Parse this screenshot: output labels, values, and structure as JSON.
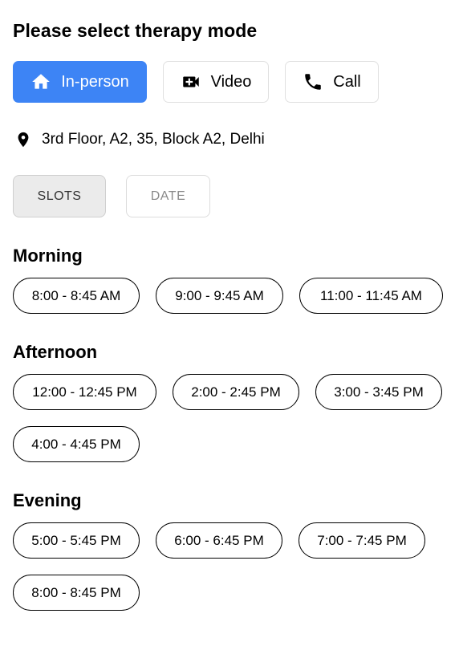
{
  "header": {
    "title": "Please select therapy mode"
  },
  "modes": [
    {
      "label": "In-person",
      "icon": "home-icon",
      "active": true
    },
    {
      "label": "Video",
      "icon": "video-camera-icon",
      "active": false
    },
    {
      "label": "Call",
      "icon": "phone-icon",
      "active": false
    }
  ],
  "address": {
    "icon": "location-pin-icon",
    "text": "3rd Floor, A2, 35, Block A2, Delhi"
  },
  "tabs": [
    {
      "label": "SLOTS",
      "active": true
    },
    {
      "label": "DATE",
      "active": false
    }
  ],
  "sections": [
    {
      "title": "Morning",
      "slots": [
        "8:00 - 8:45 AM",
        "9:00 - 9:45 AM",
        "11:00 - 11:45 AM"
      ]
    },
    {
      "title": "Afternoon",
      "slots": [
        "12:00 - 12:45 PM",
        "2:00 - 2:45 PM",
        "3:00 - 3:45 PM",
        "4:00 - 4:45 PM"
      ]
    },
    {
      "title": "Evening",
      "slots": [
        "5:00 - 5:45 PM",
        "6:00 - 6:45 PM",
        "7:00 - 7:45 PM",
        "8:00 - 8:45 PM"
      ]
    }
  ],
  "colors": {
    "accent": "#3d84f5",
    "tab_active_bg": "#ebebeb",
    "tab_inactive_text": "#8a8a8a"
  }
}
